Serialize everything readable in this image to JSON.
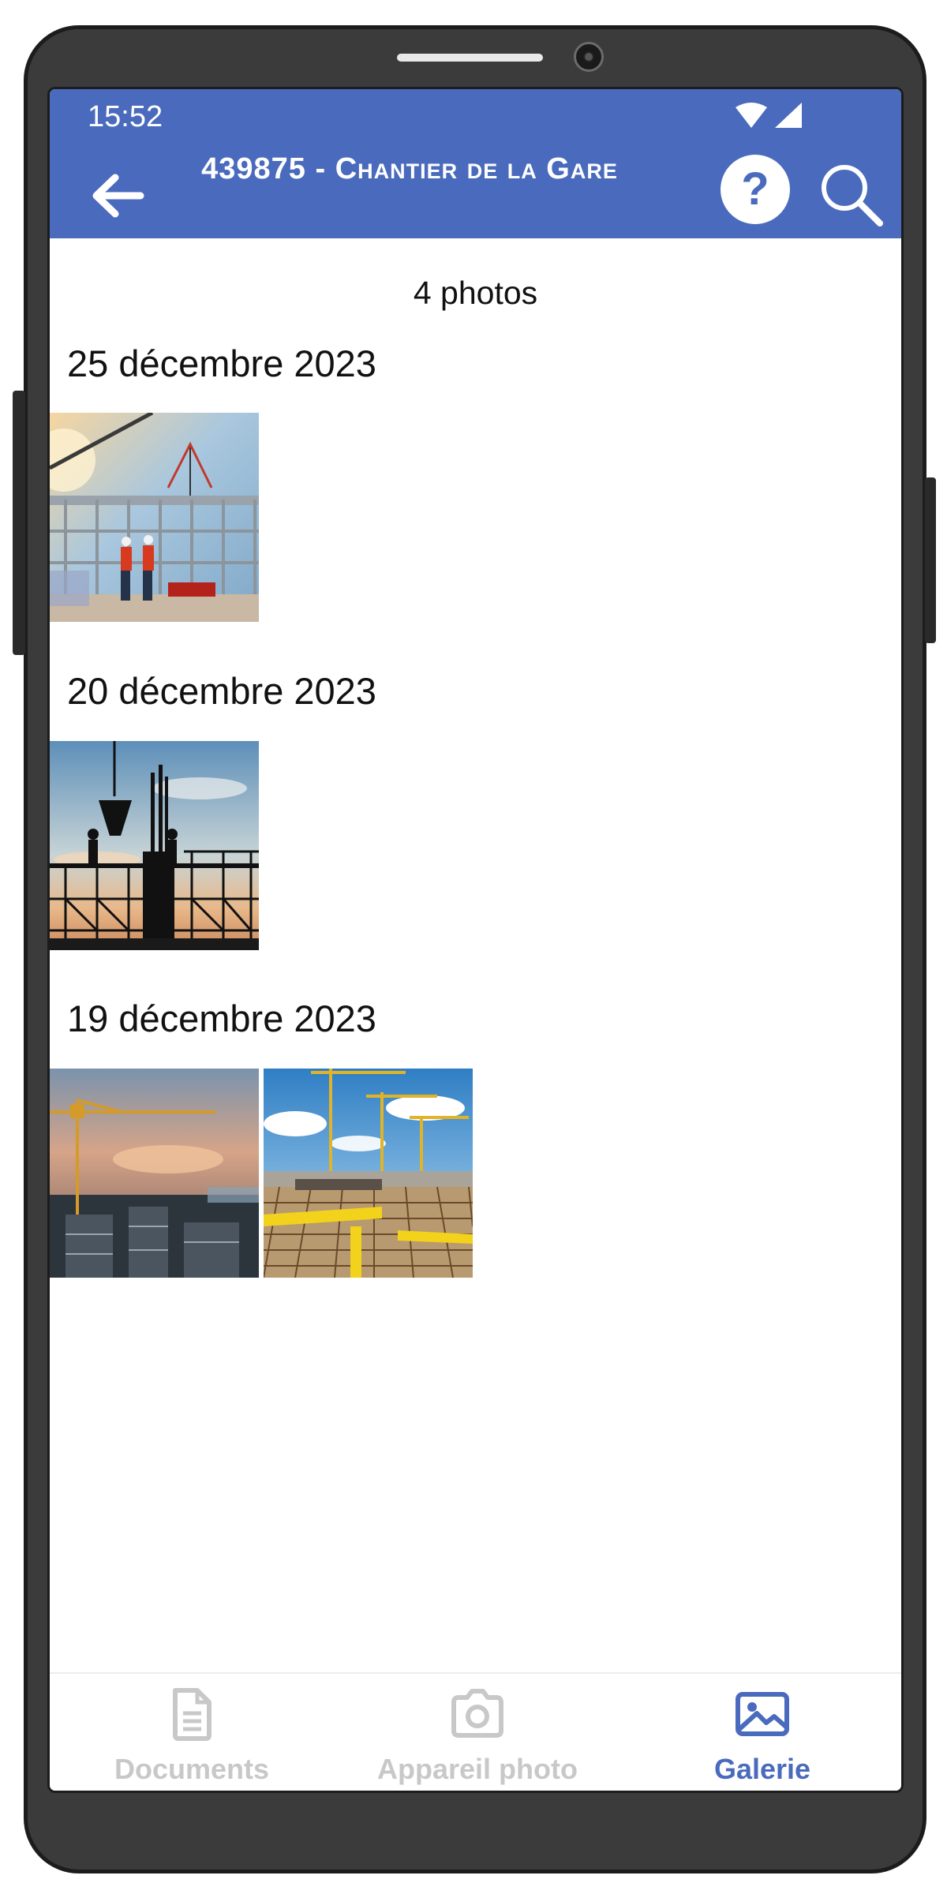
{
  "status_bar": {
    "time": "15:52"
  },
  "app_bar": {
    "title": "439875 - Chantier de la Gare",
    "help_label": "?"
  },
  "gallery": {
    "count_label": "4 photos",
    "groups": [
      {
        "date": "25 décembre 2023",
        "photos": [
          "crane-lift-workers-photo"
        ]
      },
      {
        "date": "20 décembre 2023",
        "photos": [
          "concrete-bucket-silhouette-photo"
        ]
      },
      {
        "date": "19 décembre 2023",
        "photos": [
          "tower-crane-sunset-photo",
          "rebar-site-cranes-photo"
        ]
      }
    ]
  },
  "bottom_nav": {
    "items": [
      {
        "label": "Documents",
        "icon": "document-icon",
        "active": false
      },
      {
        "label": "Appareil photo",
        "icon": "camera-icon",
        "active": false
      },
      {
        "label": "Galerie",
        "icon": "gallery-icon",
        "active": true
      }
    ]
  },
  "colors": {
    "accent": "#4a6bbd",
    "inactive": "#c8c8c8"
  }
}
